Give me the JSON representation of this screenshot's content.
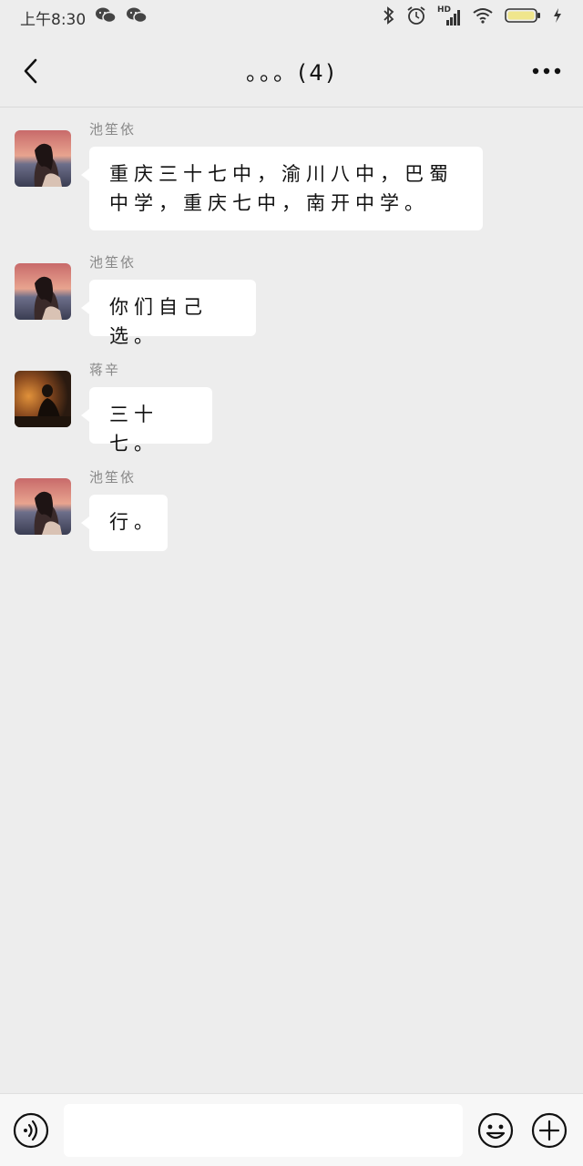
{
  "status_bar": {
    "time": "上午8:30",
    "network": "HD"
  },
  "header": {
    "title": "。。。(4)"
  },
  "messages": [
    {
      "sender": "池笙依",
      "text": "重庆三十七中，渝川八中，巴蜀中学，重庆七中，南开中学。"
    },
    {
      "sender": "池笙依",
      "text": "你们自己选。"
    },
    {
      "sender": "蒋辛",
      "text": "三十七。"
    },
    {
      "sender": "池笙依",
      "text": "行。"
    }
  ],
  "colors": {
    "background": "#ededed",
    "bubble": "#ffffff",
    "sender_text": "#888888",
    "battery_fill": "#f0e68c"
  },
  "icons": {
    "back": "chevron-left-icon",
    "more": "more-dots-icon",
    "voice": "voice-icon",
    "emoji": "emoji-icon",
    "plus": "plus-icon"
  },
  "input": {
    "value": ""
  }
}
